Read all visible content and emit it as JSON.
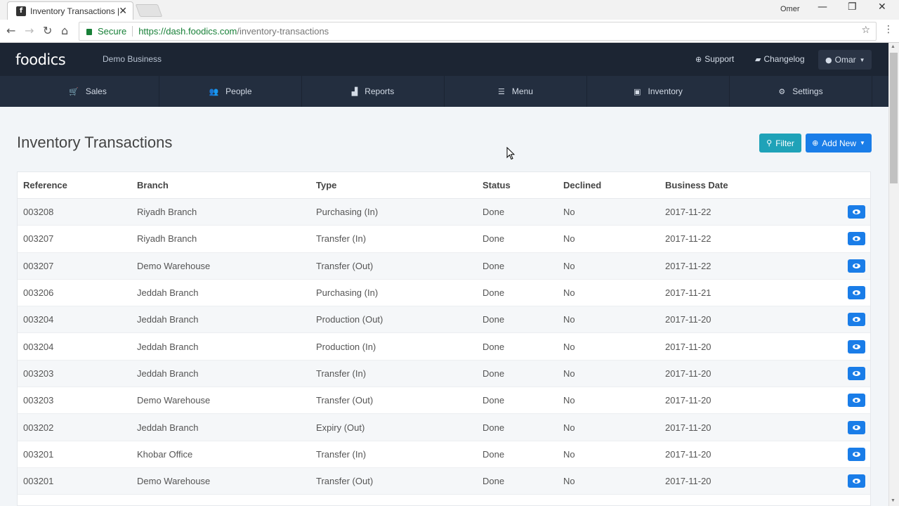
{
  "browser": {
    "tab_title": "Inventory Transactions | F",
    "tab_favicon": "f",
    "profile_name": "Omer",
    "secure_label": "Secure",
    "url_host": "https://dash.foodics.com",
    "url_path": "/inventory-transactions"
  },
  "header": {
    "logo": "foodics",
    "business": "Demo Business",
    "support": "Support",
    "changelog": "Changelog",
    "user": "Omar"
  },
  "nav": {
    "items": [
      {
        "label": "Sales",
        "icon": "cart-icon"
      },
      {
        "label": "People",
        "icon": "users-icon"
      },
      {
        "label": "Reports",
        "icon": "bar-chart-icon"
      },
      {
        "label": "Menu",
        "icon": "list-icon"
      },
      {
        "label": "Inventory",
        "icon": "box-icon"
      },
      {
        "label": "Settings",
        "icon": "gears-icon"
      }
    ]
  },
  "page": {
    "title": "Inventory Transactions",
    "filter_label": "Filter",
    "add_new_label": "Add New"
  },
  "table": {
    "headers": [
      "Reference",
      "Branch",
      "Type",
      "Status",
      "Declined",
      "Business Date"
    ],
    "rows": [
      {
        "reference": "003208",
        "branch": "Riyadh Branch",
        "type": "Purchasing (In)",
        "status": "Done",
        "declined": "No",
        "date": "2017-11-22"
      },
      {
        "reference": "003207",
        "branch": "Riyadh Branch",
        "type": "Transfer (In)",
        "status": "Done",
        "declined": "No",
        "date": "2017-11-22"
      },
      {
        "reference": "003207",
        "branch": "Demo Warehouse",
        "type": "Transfer (Out)",
        "status": "Done",
        "declined": "No",
        "date": "2017-11-22"
      },
      {
        "reference": "003206",
        "branch": "Jeddah Branch",
        "type": "Purchasing (In)",
        "status": "Done",
        "declined": "No",
        "date": "2017-11-21"
      },
      {
        "reference": "003204",
        "branch": "Jeddah Branch",
        "type": "Production (Out)",
        "status": "Done",
        "declined": "No",
        "date": "2017-11-20"
      },
      {
        "reference": "003204",
        "branch": "Jeddah Branch",
        "type": "Production (In)",
        "status": "Done",
        "declined": "No",
        "date": "2017-11-20"
      },
      {
        "reference": "003203",
        "branch": "Jeddah Branch",
        "type": "Transfer (In)",
        "status": "Done",
        "declined": "No",
        "date": "2017-11-20"
      },
      {
        "reference": "003203",
        "branch": "Demo Warehouse",
        "type": "Transfer (Out)",
        "status": "Done",
        "declined": "No",
        "date": "2017-11-20"
      },
      {
        "reference": "003202",
        "branch": "Jeddah Branch",
        "type": "Expiry (Out)",
        "status": "Done",
        "declined": "No",
        "date": "2017-11-20"
      },
      {
        "reference": "003201",
        "branch": "Khobar Office",
        "type": "Transfer (In)",
        "status": "Done",
        "declined": "No",
        "date": "2017-11-20"
      },
      {
        "reference": "003201",
        "branch": "Demo Warehouse",
        "type": "Transfer (Out)",
        "status": "Done",
        "declined": "No",
        "date": "2017-11-20"
      }
    ]
  },
  "colors": {
    "header_bg": "#1c2533",
    "nav_bg": "#232e3f",
    "filter_btn": "#1fa2b8",
    "primary_btn": "#1a7de8",
    "secure_green": "#188038"
  }
}
